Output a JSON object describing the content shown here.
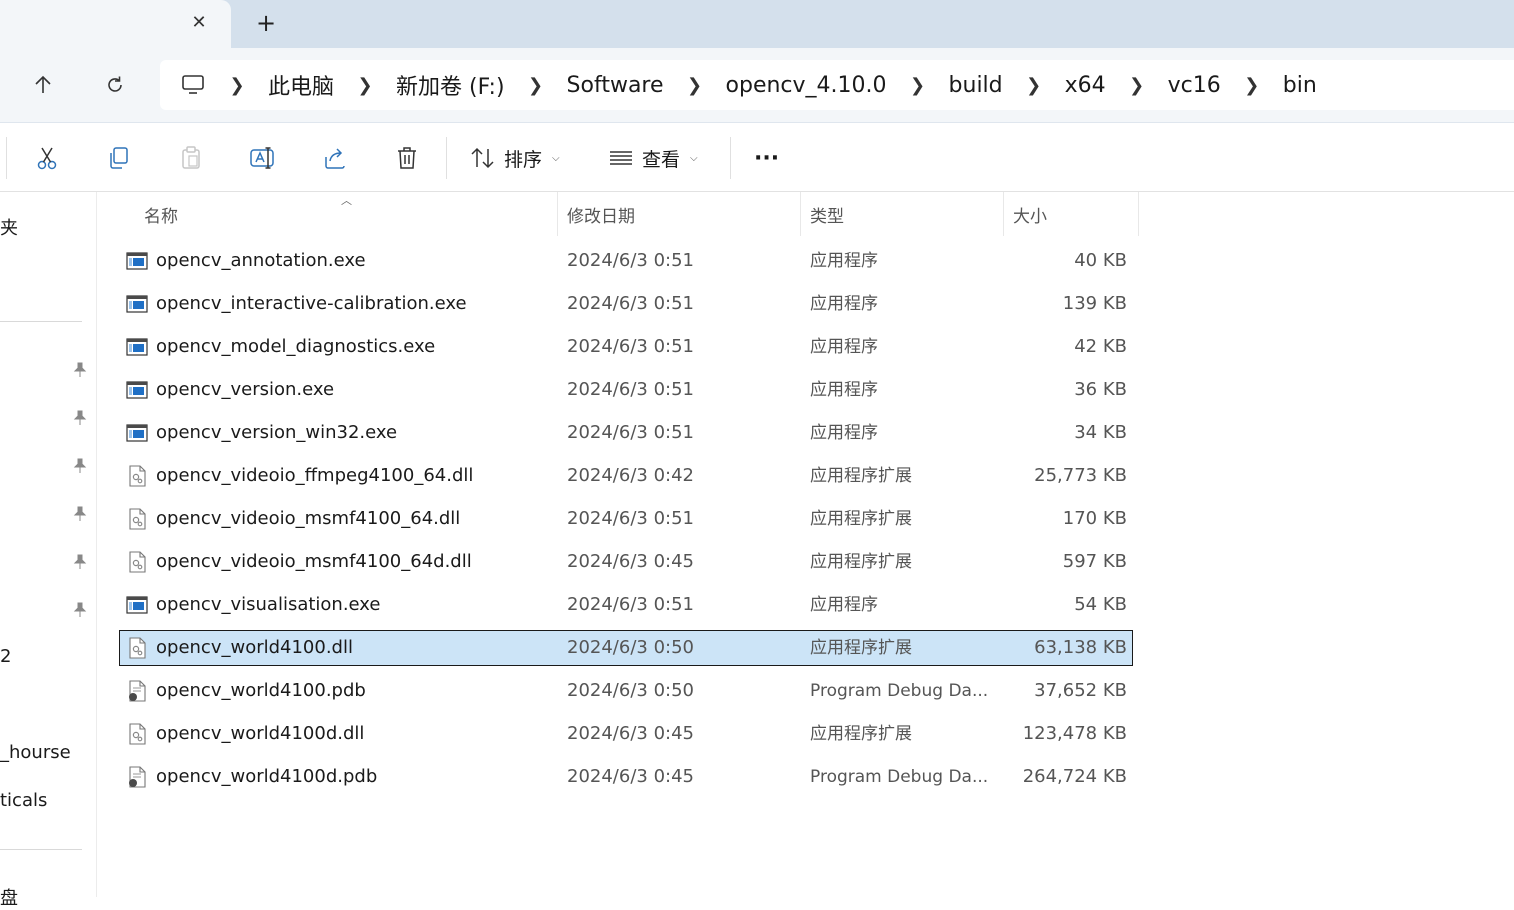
{
  "tabs": {
    "close_glyph": "✕",
    "new_tab_glyph": "+"
  },
  "nav": {
    "breadcrumb": [
      {
        "label": "此电脑"
      },
      {
        "label": "新加卷 (F:)"
      },
      {
        "label": "Software"
      },
      {
        "label": "opencv_4.10.0"
      },
      {
        "label": "build"
      },
      {
        "label": "x64"
      },
      {
        "label": "vc16"
      },
      {
        "label": "bin"
      }
    ]
  },
  "toolbar": {
    "sort_label": "排序",
    "view_label": "查看",
    "more_label": "···"
  },
  "sidebar": {
    "items": [
      "夹",
      "2",
      "_hourse",
      "ticals",
      "盘"
    ]
  },
  "columns": {
    "name": "名称",
    "date": "修改日期",
    "type": "类型",
    "size": "大小"
  },
  "files": [
    {
      "name": "opencv_annotation.exe",
      "date": "2024/6/3 0:51",
      "type": "应用程序",
      "size": "40 KB",
      "icon": "exe-icon"
    },
    {
      "name": "opencv_interactive-calibration.exe",
      "date": "2024/6/3 0:51",
      "type": "应用程序",
      "size": "139 KB",
      "icon": "exe-icon"
    },
    {
      "name": "opencv_model_diagnostics.exe",
      "date": "2024/6/3 0:51",
      "type": "应用程序",
      "size": "42 KB",
      "icon": "exe-icon"
    },
    {
      "name": "opencv_version.exe",
      "date": "2024/6/3 0:51",
      "type": "应用程序",
      "size": "36 KB",
      "icon": "exe-icon"
    },
    {
      "name": "opencv_version_win32.exe",
      "date": "2024/6/3 0:51",
      "type": "应用程序",
      "size": "34 KB",
      "icon": "exe-icon"
    },
    {
      "name": "opencv_videoio_ffmpeg4100_64.dll",
      "date": "2024/6/3 0:42",
      "type": "应用程序扩展",
      "size": "25,773 KB",
      "icon": "dll-icon"
    },
    {
      "name": "opencv_videoio_msmf4100_64.dll",
      "date": "2024/6/3 0:51",
      "type": "应用程序扩展",
      "size": "170 KB",
      "icon": "dll-icon"
    },
    {
      "name": "opencv_videoio_msmf4100_64d.dll",
      "date": "2024/6/3 0:45",
      "type": "应用程序扩展",
      "size": "597 KB",
      "icon": "dll-icon"
    },
    {
      "name": "opencv_visualisation.exe",
      "date": "2024/6/3 0:51",
      "type": "应用程序",
      "size": "54 KB",
      "icon": "exe-icon"
    },
    {
      "name": "opencv_world4100.dll",
      "date": "2024/6/3 0:50",
      "type": "应用程序扩展",
      "size": "63,138 KB",
      "icon": "dll-icon",
      "selected": true
    },
    {
      "name": "opencv_world4100.pdb",
      "date": "2024/6/3 0:50",
      "type": "Program Debug Da...",
      "size": "37,652 KB",
      "icon": "pdb-icon"
    },
    {
      "name": "opencv_world4100d.dll",
      "date": "2024/6/3 0:45",
      "type": "应用程序扩展",
      "size": "123,478 KB",
      "icon": "dll-icon"
    },
    {
      "name": "opencv_world4100d.pdb",
      "date": "2024/6/3 0:45",
      "type": "Program Debug Da...",
      "size": "264,724 KB",
      "icon": "pdb-icon"
    }
  ]
}
